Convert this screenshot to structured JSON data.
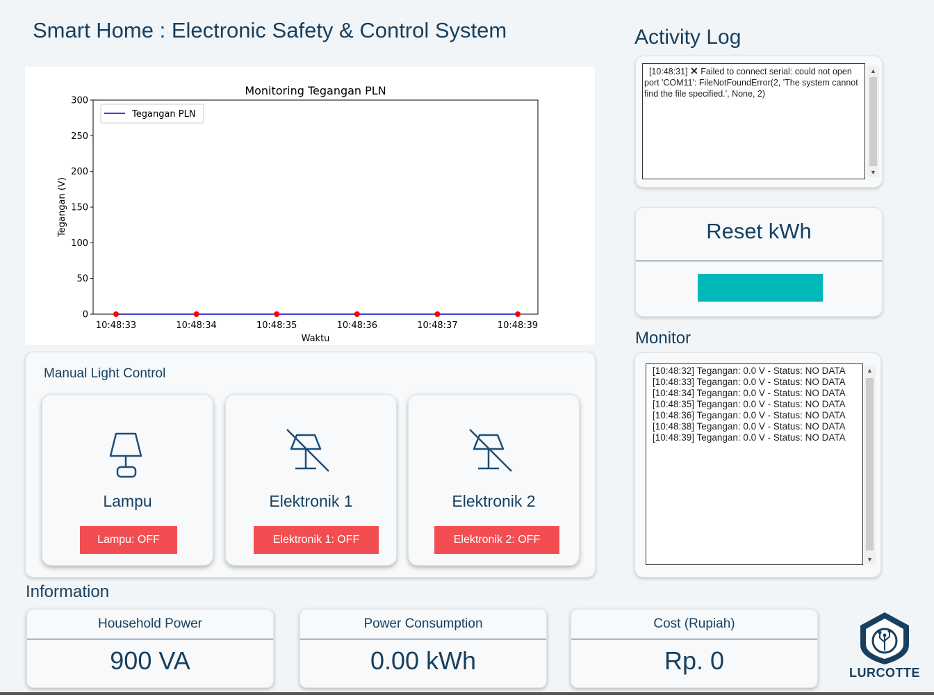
{
  "header": {
    "title": "Smart Home : Electronic Safety & Control System"
  },
  "chart_data": {
    "type": "line",
    "title": "Monitoring Tegangan PLN",
    "xlabel": "Waktu",
    "ylabel": "Tegangan (V)",
    "x": [
      "10:48:33",
      "10:48:34",
      "10:48:35",
      "10:48:36",
      "10:48:37",
      "10:48:39"
    ],
    "series": [
      {
        "name": "Tegangan PLN",
        "values": [
          0,
          0,
          0,
          0,
          0,
          0
        ]
      }
    ],
    "yticks": [
      "0",
      "50",
      "100",
      "150",
      "200",
      "250",
      "300"
    ],
    "ylim": [
      0,
      300
    ],
    "legend": "top-left",
    "grid": false,
    "colors": {
      "line": "#0000cc",
      "marker": "#ff0000"
    }
  },
  "manual": {
    "title": "Manual Light Control",
    "devices": [
      {
        "name": "Lampu",
        "button": "Lampu: OFF",
        "icon": "lamp-icon"
      },
      {
        "name": "Elektronik 1",
        "button": "Elektronik 1: OFF",
        "icon": "device-off-icon"
      },
      {
        "name": "Elektronik 2",
        "button": "Elektronik 2: OFF",
        "icon": "device-off-icon"
      }
    ]
  },
  "activity_log": {
    "title": "Activity Log",
    "timestamp": "[10:48:31]",
    "message": "Failed to connect serial: could not open port 'COM11': FileNotFoundError(2, 'The system cannot find the file specified.', None, 2)",
    "icon": "error-x-icon"
  },
  "reset": {
    "title": "Reset kWh"
  },
  "monitor": {
    "title": "Monitor",
    "lines": [
      "[10:48:32] Tegangan: 0.0 V - Status:  NO DATA",
      "[10:48:33] Tegangan: 0.0 V - Status:  NO DATA",
      "[10:48:34] Tegangan: 0.0 V - Status:  NO DATA",
      "[10:48:35] Tegangan: 0.0 V - Status:  NO DATA",
      "[10:48:36] Tegangan: 0.0 V - Status:  NO DATA",
      "[10:48:38] Tegangan: 0.0 V - Status:  NO DATA",
      "[10:48:39] Tegangan: 0.0 V - Status:  NO DATA"
    ]
  },
  "information": {
    "title": "Information",
    "cards": [
      {
        "label": "Household Power",
        "value": "900 VA"
      },
      {
        "label": "Power Consumption",
        "value": "0.00 kWh"
      },
      {
        "label": "Cost (Rupiah)",
        "value": "Rp. 0"
      }
    ]
  },
  "brand": {
    "name": "LURCOTTE",
    "icon": "shield-circuit-logo"
  },
  "colors": {
    "primary": "#173f5f",
    "off_button": "#f24e51",
    "reset_button": "#00b8b8"
  }
}
